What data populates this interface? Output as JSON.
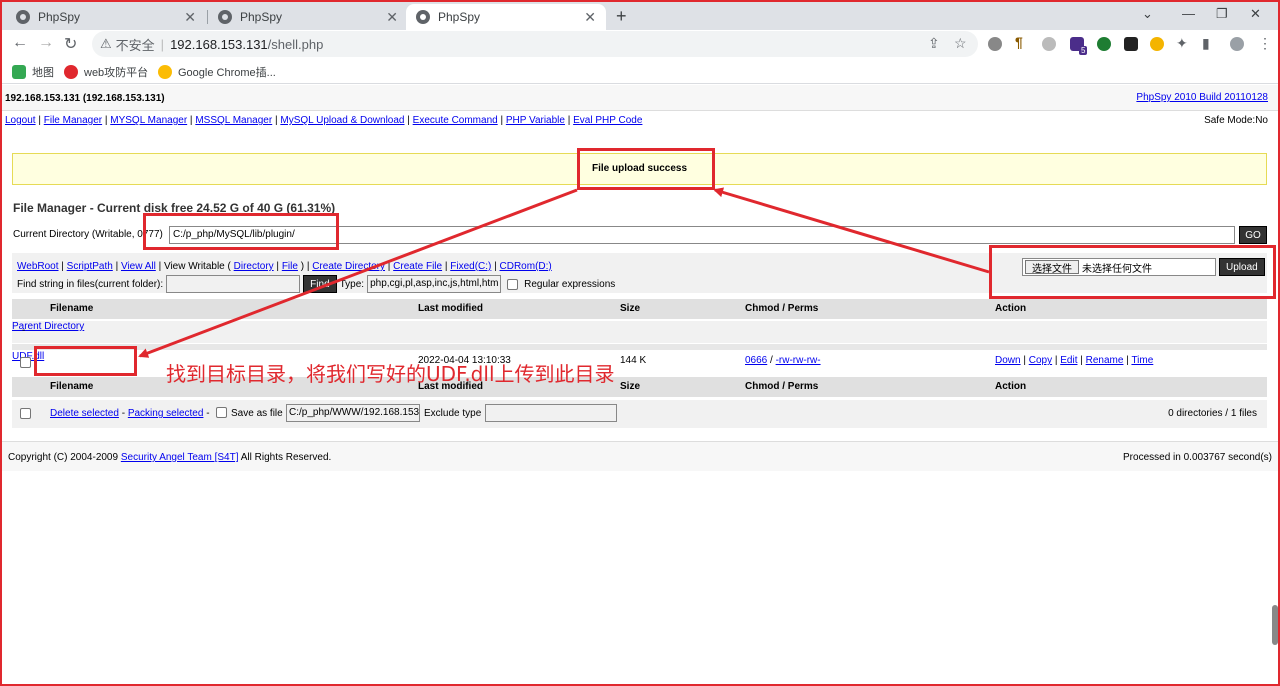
{
  "browser": {
    "tabs": [
      {
        "title": "PhpSpy",
        "active": false
      },
      {
        "title": "PhpSpy",
        "active": false
      },
      {
        "title": "PhpSpy",
        "active": true
      }
    ],
    "address": {
      "security_label": "不安全",
      "host": "192.168.153.131",
      "path": "/shell.php"
    },
    "bookmarks": [
      "地图",
      "web攻防平台",
      "Google Chrome插..."
    ],
    "extension_badge": "5"
  },
  "page": {
    "host_title": "192.168.153.131 (192.168.153.131)",
    "version_link": "PhpSpy 2010 Build 20110128",
    "menu": [
      "Logout",
      "File Manager",
      "MYSQL Manager",
      "MSSQL Manager",
      "MySQL Upload & Download",
      "Execute Command",
      "PHP Variable",
      "Eval PHP Code"
    ],
    "safe_mode": "Safe Mode:No",
    "message": "File upload success",
    "fm_title": "File Manager - Current disk free 24.52 G of 40 G (61.31%)",
    "current_dir_label": "Current Directory (Writable, 0777)",
    "current_dir_value": "C:/p_php/MySQL/lib/plugin/",
    "go_label": "GO",
    "tool_links": {
      "webroot": "WebRoot",
      "scriptpath": "ScriptPath",
      "viewall": "View All",
      "viewwritable": "View Writable",
      "directory": "Directory",
      "file": "File",
      "createdir": "Create Directory",
      "createfile": "Create File",
      "fixed": "Fixed(C:)",
      "cdrom": "CDRom(D:)"
    },
    "find_label": "Find string in files(current folder):",
    "find_button": "Find",
    "type_label": "Type:",
    "type_value": "php,cgi,pl,asp,inc,js,html,htm",
    "regex_label": "Regular expressions",
    "upload": {
      "choose_button": "选择文件",
      "no_file": "未选择任何文件",
      "upload_button": "Upload"
    },
    "columns": [
      "Filename",
      "Last modified",
      "Size",
      "Chmod / Perms",
      "Action"
    ],
    "parent_dash": "-",
    "parent_label": "Parent Directory",
    "file_row": {
      "name": "UDF.dll",
      "modified": "2022-04-04 13:10:33",
      "size": "144 K",
      "chmod": "0666",
      "perms": "-rw-rw-rw-",
      "actions": [
        "Down",
        "Copy",
        "Edit",
        "Rename",
        "Time"
      ]
    },
    "bottom": {
      "delete": "Delete selected",
      "packing": "Packing selected",
      "save_as_label": "Save as file",
      "save_as_value": "C:/p_php/WWW/192.168.153.",
      "exclude_label": "Exclude type",
      "summary": "0 directories / 1 files"
    },
    "footer": {
      "copy_prefix": "Copyright (C) 2004-2009",
      "team": "Security Angel Team [S4T]",
      "copy_suffix": "All Rights Reserved.",
      "processed": "Processed in 0.003767 second(s)"
    }
  },
  "annotation": {
    "note": "找到目标目录，将我们写好的UDF.dll上传到此目录",
    "color": "#e0282e"
  }
}
